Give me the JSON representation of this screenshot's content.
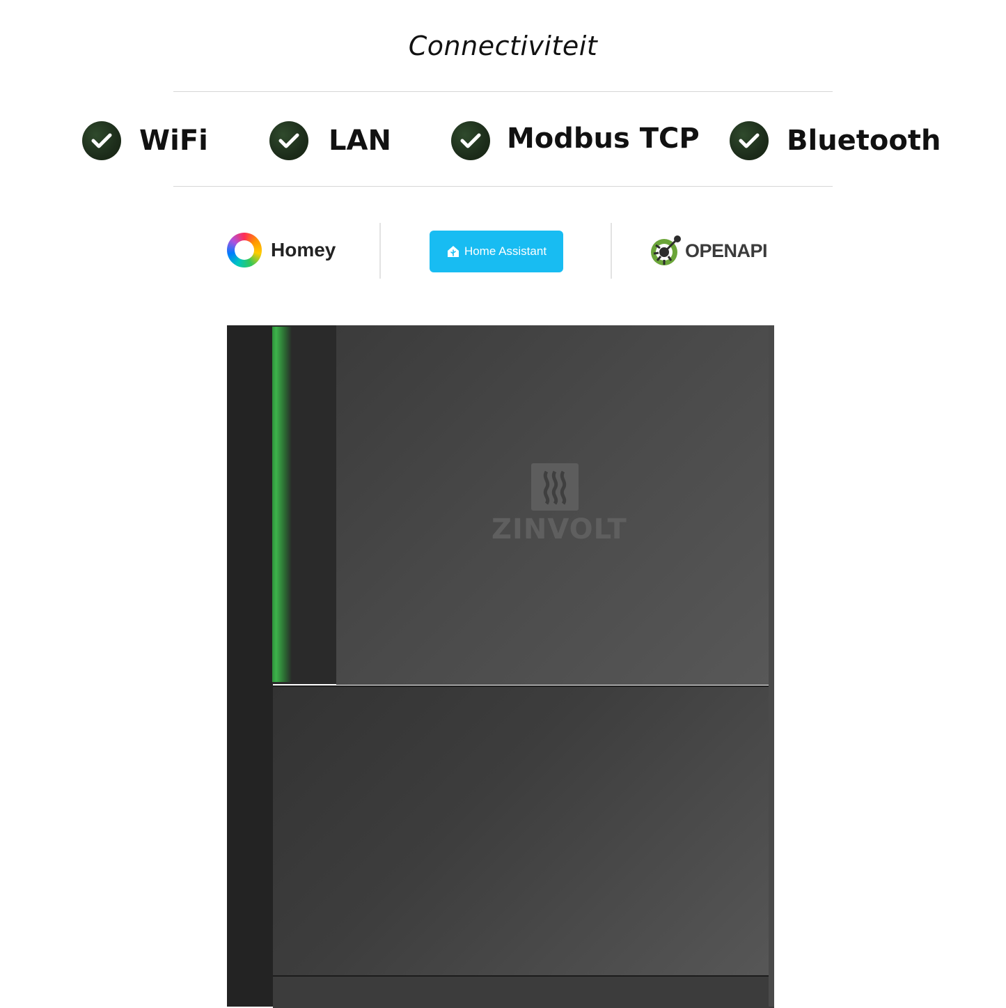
{
  "heading": "Connectiviteit",
  "features": [
    {
      "label": "WiFi",
      "icon": "check-circle-icon"
    },
    {
      "label": "LAN",
      "icon": "check-circle-icon"
    },
    {
      "label": "Modbus TCP",
      "icon": "check-circle-icon"
    },
    {
      "label": "Bluetooth",
      "icon": "check-circle-icon"
    }
  ],
  "integrations": {
    "homey": {
      "label": "Homey",
      "icon": "homey-ring-logo"
    },
    "home_assistant": {
      "label": "Home Assistant",
      "icon": "home-assistant-house-logo",
      "color": "#18BCF2"
    },
    "openapi": {
      "label": "OPENAPI",
      "icon": "openapi-logo",
      "color": "#6BA539"
    }
  },
  "product": {
    "brand": "ZINVOLT",
    "led_color": "#3FBF4E",
    "body_color": "#3B3B3B"
  }
}
